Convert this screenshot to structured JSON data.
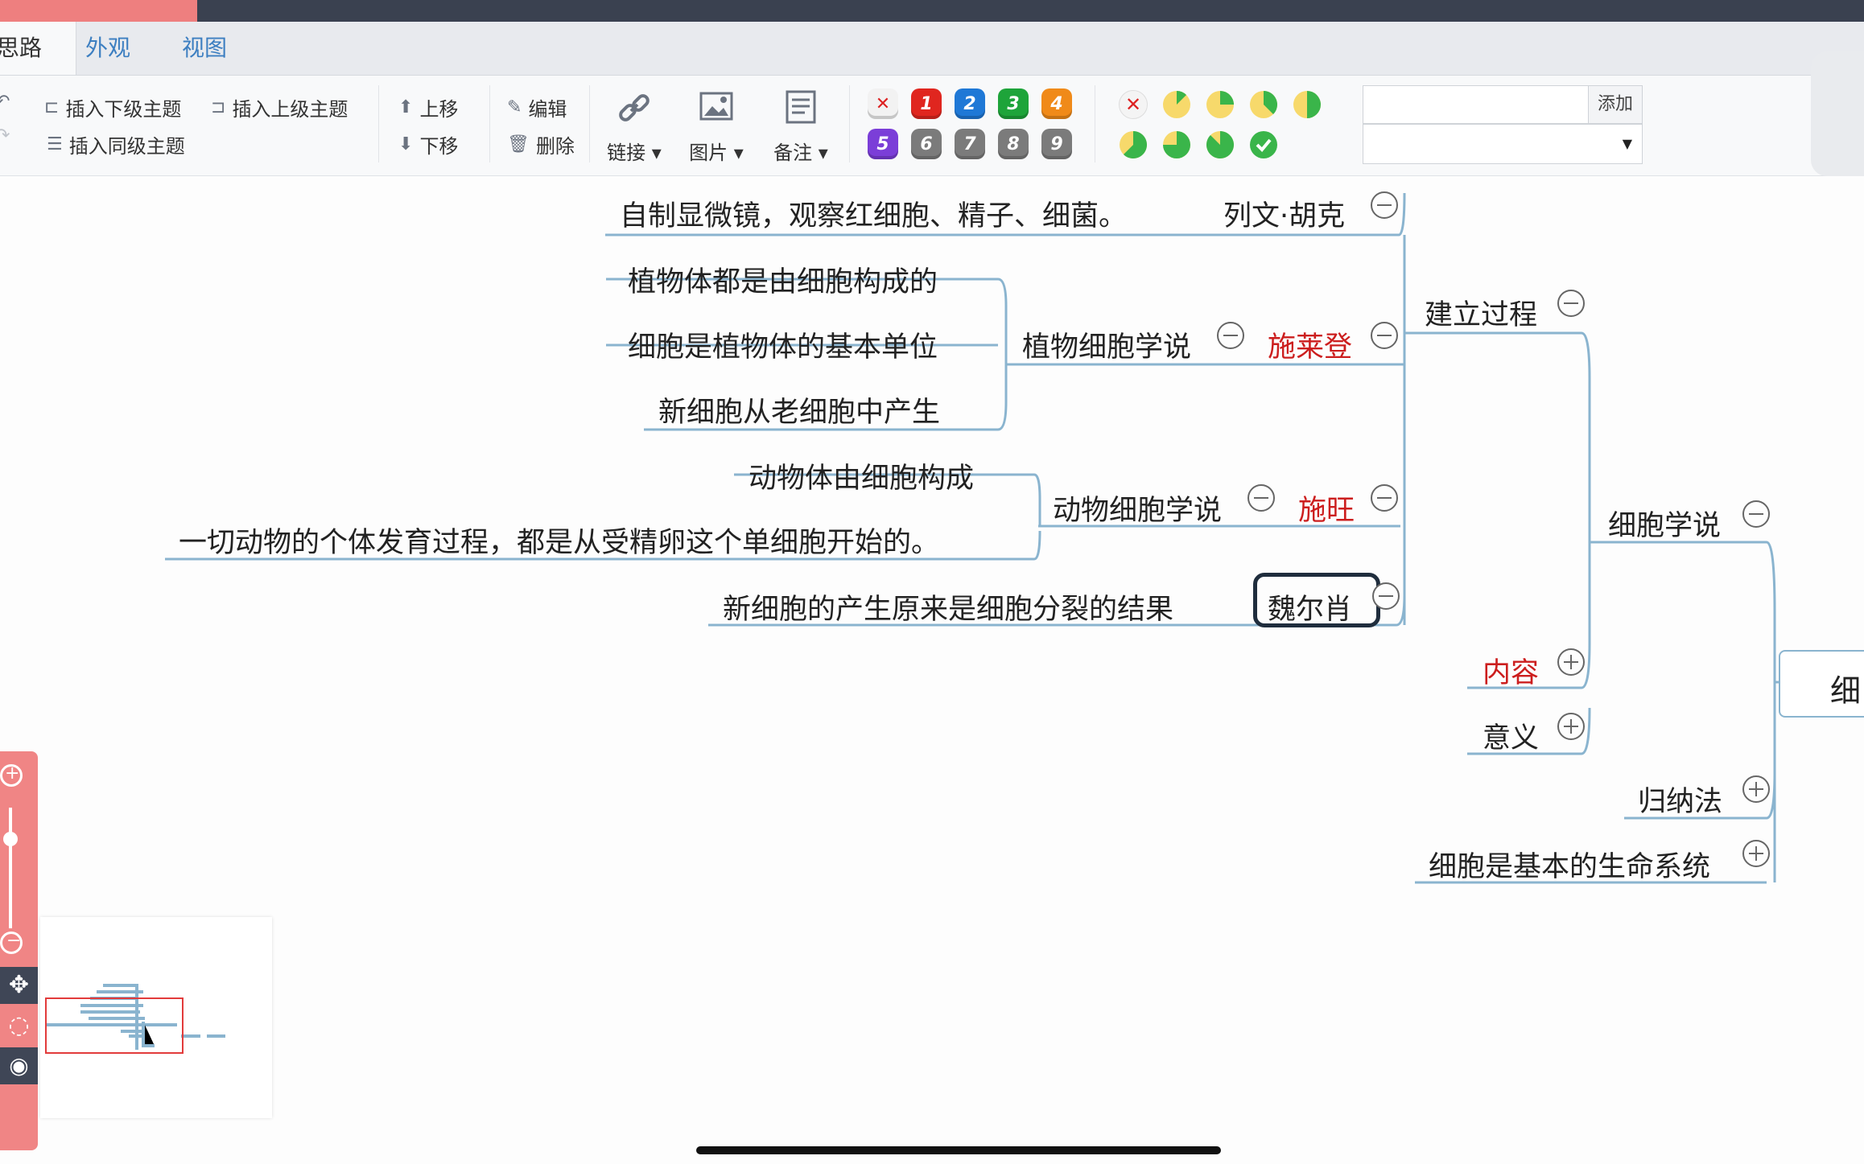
{
  "tabs": [
    "思路",
    "外观",
    "视图"
  ],
  "toolbar": {
    "insert_child": "插入下级主题",
    "insert_parent": "插入上级主题",
    "insert_sibling": "插入同级主题",
    "move_up": "上移",
    "move_down": "下移",
    "edit": "编辑",
    "delete": "删除",
    "link": "链接",
    "image": "图片",
    "note": "备注",
    "add": "添加"
  },
  "priority_badges": [
    {
      "label": "1",
      "color": "#e0261f"
    },
    {
      "label": "2",
      "color": "#1f78d6"
    },
    {
      "label": "3",
      "color": "#1ea43a"
    },
    {
      "label": "4",
      "color": "#f08a19"
    },
    {
      "label": "5",
      "color": "#7b3ed8"
    },
    {
      "label": "6",
      "color": "#7b7b7b"
    },
    {
      "label": "7",
      "color": "#7b7b7b"
    },
    {
      "label": "8",
      "color": "#7b7b7b"
    },
    {
      "label": "9",
      "color": "#7b7b7b"
    }
  ],
  "progress_levels": [
    0,
    0.125,
    0.25,
    0.375,
    0.5,
    0.625,
    0.75,
    0.875,
    1
  ],
  "mindmap": {
    "n1": "自制显微镜，观察红细胞、精子、细菌。",
    "n2": "列文·胡克",
    "n3": "植物体都是由细胞构成的",
    "n4": "细胞是植物体的基本单位",
    "n5": "新细胞从老细胞中产生",
    "n6": "植物细胞学说",
    "n7": "施莱登",
    "n8": "建立过程",
    "n9": "动物体由细胞构成",
    "n10": "一切动物的个体发育过程，都是从受精卵这个单细胞开始的。",
    "n11": "动物细胞学说",
    "n12": "施旺",
    "n13": "细胞学说",
    "n14": "新细胞的产生原来是细胞分裂的结果",
    "n15": "魏尔肖",
    "n16": "内容",
    "n17": "意义",
    "n18": "归纳法",
    "n19": "细胞是基本的生命系统",
    "root": "细"
  },
  "colors": {
    "accent": "#ee7f7f",
    "link": "#3d7fc1",
    "branch": "#8ab4cf",
    "red_text": "#cc1e1e"
  }
}
